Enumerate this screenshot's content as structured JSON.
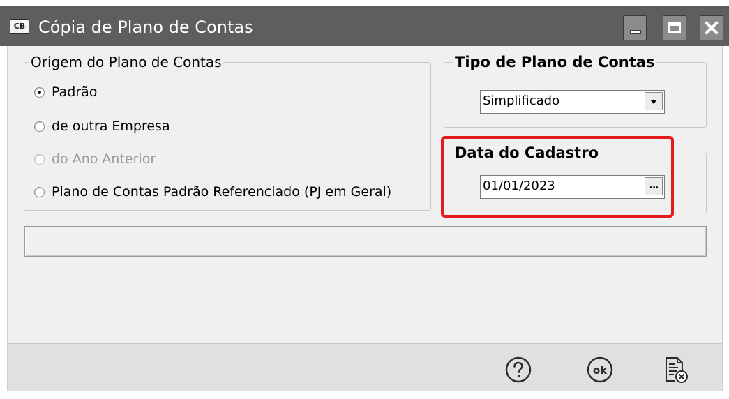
{
  "window": {
    "title": "Cópia de Plano de Contas",
    "app_icon_label": "CB"
  },
  "origem": {
    "legend": "Origem do Plano de Contas",
    "options": [
      {
        "label": "Padrão",
        "checked": true,
        "enabled": true
      },
      {
        "label": "de outra Empresa",
        "checked": false,
        "enabled": true
      },
      {
        "label": "do Ano Anterior",
        "checked": false,
        "enabled": false
      },
      {
        "label": "Plano de Contas Padrão Referenciado (PJ em Geral)",
        "checked": false,
        "enabled": true
      }
    ]
  },
  "tipo": {
    "legend": "Tipo de Plano de Contas",
    "selected": "Simplificado"
  },
  "data_cadastro": {
    "legend": "Data do Cadastro",
    "value": "01/01/2023",
    "button_label": "..."
  },
  "colors": {
    "highlight": "#e51b1b",
    "titlebar": "#5e5e5e"
  },
  "icons": {
    "help": "question-circle-icon",
    "ok": "ok-circle-icon",
    "cancel": "document-cancel-icon"
  }
}
